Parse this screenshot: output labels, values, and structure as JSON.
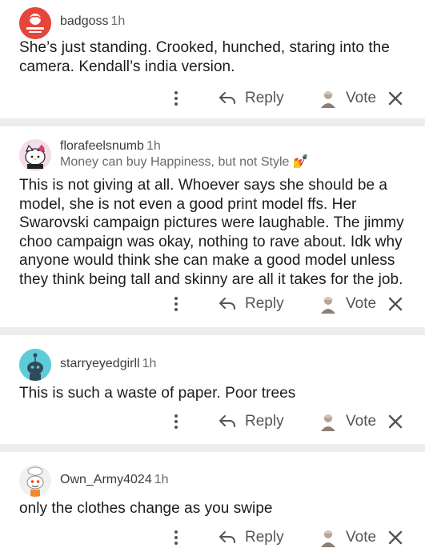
{
  "comments": [
    {
      "username": "badgoss",
      "time": "1h",
      "flair": "",
      "avatar": "avatar-red-logo-icon",
      "body": "She’s just standing. Crooked, hunched, staring into the camera. Kendall’s india version.",
      "reply_label": "Reply",
      "vote_label": "Vote"
    },
    {
      "username": "florafeelsnumb",
      "time": "1h",
      "flair": "Money can buy Happiness, but not Style 💅",
      "avatar": "avatar-hello-kitty-icon",
      "body": "This is not giving at all. Whoever says she should be a model, she is not even a good print model ffs. Her Swarovski campaign pictures were laughable. The jimmy choo campaign was okay, nothing to rave about. Idk why anyone would think she can make a good model unless they think being tall and skinny are all it takes for the job.",
      "reply_label": "Reply",
      "vote_label": "Vote"
    },
    {
      "username": "starryeyedgirll",
      "time": "1h",
      "flair": "",
      "avatar": "avatar-snoo-teal-icon",
      "body": "This is such a waste of paper. Poor trees",
      "reply_label": "Reply",
      "vote_label": "Vote"
    },
    {
      "username": "Own_Army4024",
      "time": "1h",
      "flair": "",
      "avatar": "avatar-snoo-chef-icon",
      "body": "only the clothes change as you swipe",
      "reply_label": "Reply",
      "vote_label": "Vote"
    }
  ],
  "colors": {
    "separator": "#ededed",
    "text": "#1c1c1c",
    "muted": "#555555"
  }
}
